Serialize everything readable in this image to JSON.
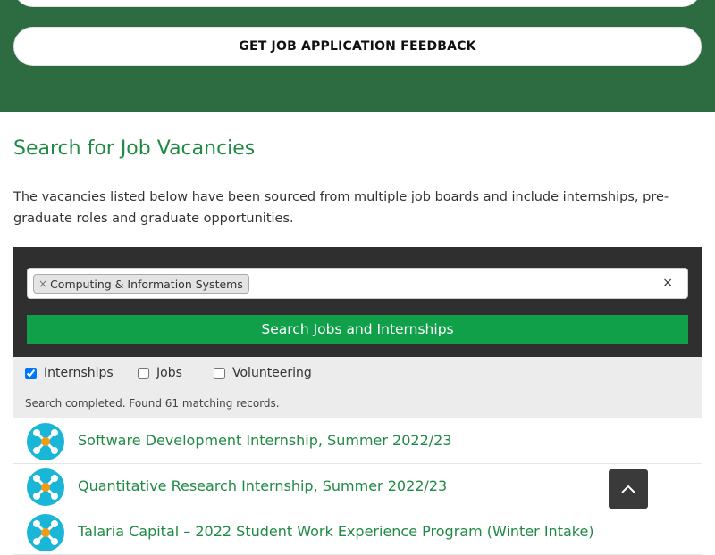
{
  "header": {
    "feedback_button": "GET JOB APPLICATION FEEDBACK"
  },
  "main": {
    "title": "Search for Job Vacancies",
    "intro": "The vacancies listed below have been sourced from multiple job boards and include internships, pre-graduate roles and graduate opportunities."
  },
  "search": {
    "tag_remove": "×",
    "tag_label": "Computing & Information Systems",
    "clear_all": "×",
    "button_label": "Search Jobs and Internships"
  },
  "filters": [
    {
      "label": "Internships",
      "checked": true
    },
    {
      "label": "Jobs",
      "checked": false
    },
    {
      "label": "Volunteering",
      "checked": false
    }
  ],
  "status": "Search completed. Found 61 matching records.",
  "results": [
    {
      "title": "Software Development Internship, Summer 2022/23",
      "icon": "person-logo-icon"
    },
    {
      "title": "Quantitative Research Internship, Summer 2022/23",
      "icon": "person-logo-icon"
    },
    {
      "title": "Talaria Capital – 2022 Student Work Experience Program (Winter Intake)",
      "icon": "person-logo-icon"
    }
  ],
  "colors": {
    "band": "#2d6b41",
    "accent": "#1f8a44",
    "button": "#10a04a",
    "logo": "#19b6d8"
  }
}
